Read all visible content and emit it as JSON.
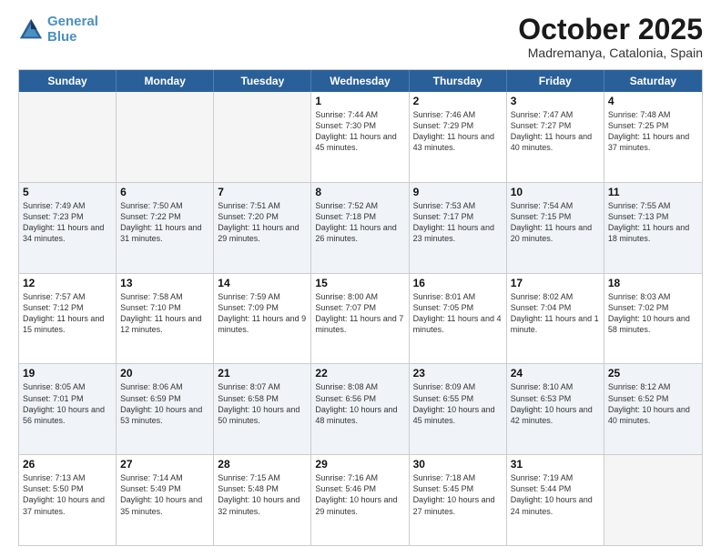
{
  "header": {
    "logo_line1": "General",
    "logo_line2": "Blue",
    "month": "October 2025",
    "location": "Madremanya, Catalonia, Spain"
  },
  "weekdays": [
    "Sunday",
    "Monday",
    "Tuesday",
    "Wednesday",
    "Thursday",
    "Friday",
    "Saturday"
  ],
  "rows": [
    [
      {
        "day": "",
        "text": ""
      },
      {
        "day": "",
        "text": ""
      },
      {
        "day": "",
        "text": ""
      },
      {
        "day": "1",
        "text": "Sunrise: 7:44 AM\nSunset: 7:30 PM\nDaylight: 11 hours\nand 45 minutes."
      },
      {
        "day": "2",
        "text": "Sunrise: 7:46 AM\nSunset: 7:29 PM\nDaylight: 11 hours\nand 43 minutes."
      },
      {
        "day": "3",
        "text": "Sunrise: 7:47 AM\nSunset: 7:27 PM\nDaylight: 11 hours\nand 40 minutes."
      },
      {
        "day": "4",
        "text": "Sunrise: 7:48 AM\nSunset: 7:25 PM\nDaylight: 11 hours\nand 37 minutes."
      }
    ],
    [
      {
        "day": "5",
        "text": "Sunrise: 7:49 AM\nSunset: 7:23 PM\nDaylight: 11 hours\nand 34 minutes."
      },
      {
        "day": "6",
        "text": "Sunrise: 7:50 AM\nSunset: 7:22 PM\nDaylight: 11 hours\nand 31 minutes."
      },
      {
        "day": "7",
        "text": "Sunrise: 7:51 AM\nSunset: 7:20 PM\nDaylight: 11 hours\nand 29 minutes."
      },
      {
        "day": "8",
        "text": "Sunrise: 7:52 AM\nSunset: 7:18 PM\nDaylight: 11 hours\nand 26 minutes."
      },
      {
        "day": "9",
        "text": "Sunrise: 7:53 AM\nSunset: 7:17 PM\nDaylight: 11 hours\nand 23 minutes."
      },
      {
        "day": "10",
        "text": "Sunrise: 7:54 AM\nSunset: 7:15 PM\nDaylight: 11 hours\nand 20 minutes."
      },
      {
        "day": "11",
        "text": "Sunrise: 7:55 AM\nSunset: 7:13 PM\nDaylight: 11 hours\nand 18 minutes."
      }
    ],
    [
      {
        "day": "12",
        "text": "Sunrise: 7:57 AM\nSunset: 7:12 PM\nDaylight: 11 hours\nand 15 minutes."
      },
      {
        "day": "13",
        "text": "Sunrise: 7:58 AM\nSunset: 7:10 PM\nDaylight: 11 hours\nand 12 minutes."
      },
      {
        "day": "14",
        "text": "Sunrise: 7:59 AM\nSunset: 7:09 PM\nDaylight: 11 hours\nand 9 minutes."
      },
      {
        "day": "15",
        "text": "Sunrise: 8:00 AM\nSunset: 7:07 PM\nDaylight: 11 hours\nand 7 minutes."
      },
      {
        "day": "16",
        "text": "Sunrise: 8:01 AM\nSunset: 7:05 PM\nDaylight: 11 hours\nand 4 minutes."
      },
      {
        "day": "17",
        "text": "Sunrise: 8:02 AM\nSunset: 7:04 PM\nDaylight: 11 hours\nand 1 minute."
      },
      {
        "day": "18",
        "text": "Sunrise: 8:03 AM\nSunset: 7:02 PM\nDaylight: 10 hours\nand 58 minutes."
      }
    ],
    [
      {
        "day": "19",
        "text": "Sunrise: 8:05 AM\nSunset: 7:01 PM\nDaylight: 10 hours\nand 56 minutes."
      },
      {
        "day": "20",
        "text": "Sunrise: 8:06 AM\nSunset: 6:59 PM\nDaylight: 10 hours\nand 53 minutes."
      },
      {
        "day": "21",
        "text": "Sunrise: 8:07 AM\nSunset: 6:58 PM\nDaylight: 10 hours\nand 50 minutes."
      },
      {
        "day": "22",
        "text": "Sunrise: 8:08 AM\nSunset: 6:56 PM\nDaylight: 10 hours\nand 48 minutes."
      },
      {
        "day": "23",
        "text": "Sunrise: 8:09 AM\nSunset: 6:55 PM\nDaylight: 10 hours\nand 45 minutes."
      },
      {
        "day": "24",
        "text": "Sunrise: 8:10 AM\nSunset: 6:53 PM\nDaylight: 10 hours\nand 42 minutes."
      },
      {
        "day": "25",
        "text": "Sunrise: 8:12 AM\nSunset: 6:52 PM\nDaylight: 10 hours\nand 40 minutes."
      }
    ],
    [
      {
        "day": "26",
        "text": "Sunrise: 7:13 AM\nSunset: 5:50 PM\nDaylight: 10 hours\nand 37 minutes."
      },
      {
        "day": "27",
        "text": "Sunrise: 7:14 AM\nSunset: 5:49 PM\nDaylight: 10 hours\nand 35 minutes."
      },
      {
        "day": "28",
        "text": "Sunrise: 7:15 AM\nSunset: 5:48 PM\nDaylight: 10 hours\nand 32 minutes."
      },
      {
        "day": "29",
        "text": "Sunrise: 7:16 AM\nSunset: 5:46 PM\nDaylight: 10 hours\nand 29 minutes."
      },
      {
        "day": "30",
        "text": "Sunrise: 7:18 AM\nSunset: 5:45 PM\nDaylight: 10 hours\nand 27 minutes."
      },
      {
        "day": "31",
        "text": "Sunrise: 7:19 AM\nSunset: 5:44 PM\nDaylight: 10 hours\nand 24 minutes."
      },
      {
        "day": "",
        "text": ""
      }
    ]
  ]
}
